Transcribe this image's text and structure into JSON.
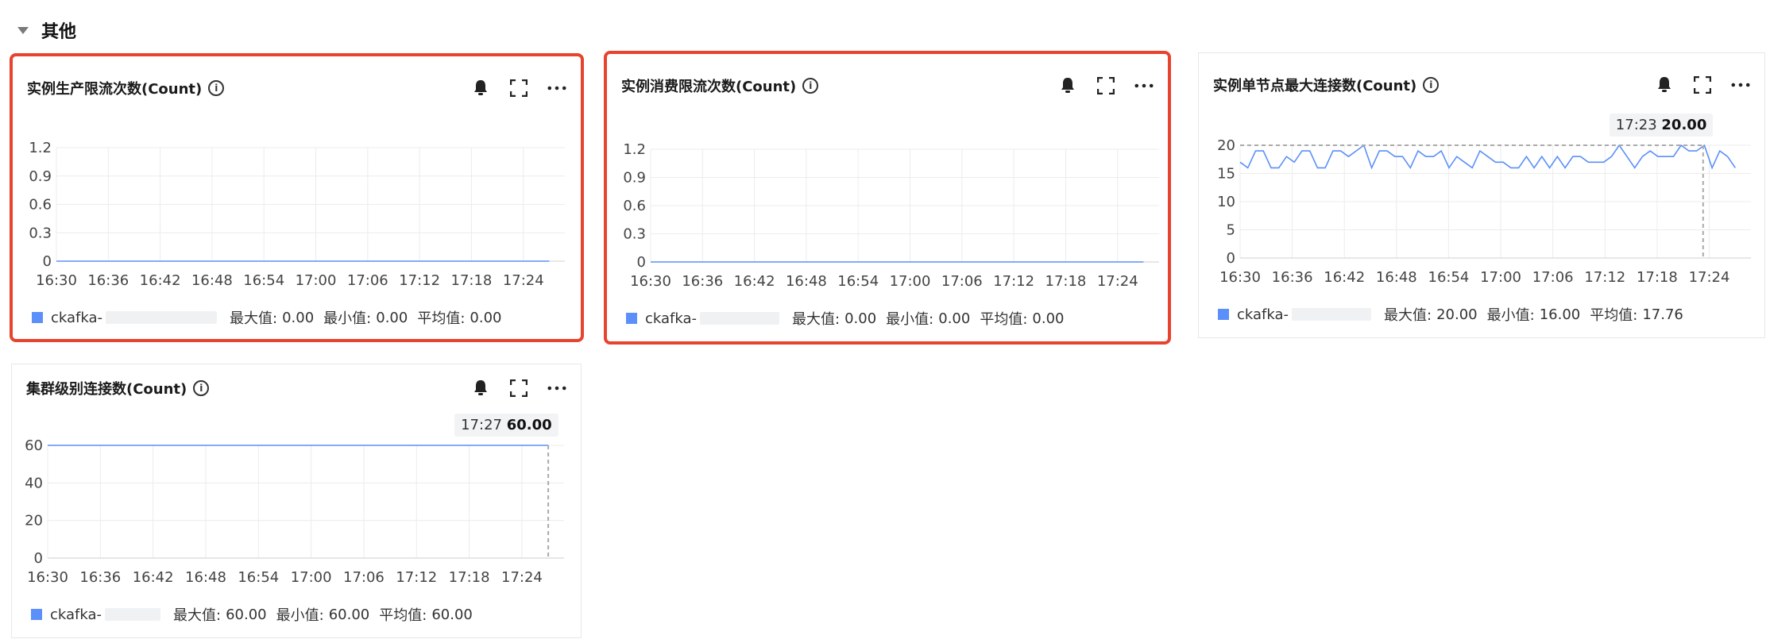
{
  "section": {
    "title": "其他"
  },
  "legend_labels": {
    "max": "最大值:",
    "min": "最小值:",
    "avg": "平均值:"
  },
  "colors": {
    "series": "#5b8ff9",
    "highlight": "#e8432e"
  },
  "cards": [
    {
      "title": "实例生产限流次数(Count)",
      "legend_name": "ckafka-",
      "stats": {
        "max": "0.00",
        "min": "0.00",
        "avg": "0.00"
      },
      "chart_data": {
        "type": "line",
        "x": [
          "16:30",
          "16:36",
          "16:42",
          "16:48",
          "16:54",
          "17:00",
          "17:06",
          "17:12",
          "17:18",
          "17:24"
        ],
        "yticks": [
          "1.2",
          "0.9",
          "0.6",
          "0.3",
          "0"
        ],
        "ylim": [
          0,
          1.2
        ],
        "series": [
          {
            "name": "ckafka-",
            "values": [
              0,
              0,
              0,
              0,
              0,
              0,
              0,
              0,
              0,
              0,
              0
            ]
          }
        ]
      }
    },
    {
      "title": "实例消费限流次数(Count)",
      "legend_name": "ckafka-",
      "stats": {
        "max": "0.00",
        "min": "0.00",
        "avg": "0.00"
      },
      "chart_data": {
        "type": "line",
        "x": [
          "16:30",
          "16:36",
          "16:42",
          "16:48",
          "16:54",
          "17:00",
          "17:06",
          "17:12",
          "17:18",
          "17:24"
        ],
        "yticks": [
          "1.2",
          "0.9",
          "0.6",
          "0.3",
          "0"
        ],
        "ylim": [
          0,
          1.2
        ],
        "series": [
          {
            "name": "ckafka-",
            "values": [
              0,
              0,
              0,
              0,
              0,
              0,
              0,
              0,
              0,
              0,
              0
            ]
          }
        ]
      }
    },
    {
      "title": "实例单节点最大连接数(Count)",
      "legend_name": "ckafka-",
      "stats": {
        "max": "20.00",
        "min": "16.00",
        "avg": "17.76"
      },
      "tooltip": {
        "time": "17:23",
        "value": "20.00"
      },
      "chart_data": {
        "type": "line",
        "x": [
          "16:30",
          "16:36",
          "16:42",
          "16:48",
          "16:54",
          "17:00",
          "17:06",
          "17:12",
          "17:18",
          "17:24"
        ],
        "yticks": [
          "20",
          "15",
          "10",
          "5",
          "0"
        ],
        "ylim": [
          0,
          20
        ],
        "series": [
          {
            "name": "ckafka-",
            "values": [
              17,
              16,
              19,
              19,
              16,
              16,
              18,
              17,
              19,
              19,
              16,
              16,
              19,
              19,
              18,
              19,
              20,
              16,
              19,
              19,
              18,
              18,
              16,
              19,
              18,
              18,
              19,
              16,
              18,
              17,
              16,
              19,
              18,
              17,
              17,
              16,
              16,
              18,
              16,
              18,
              16,
              18,
              16,
              18,
              18,
              17,
              17,
              17,
              18,
              20,
              18,
              16,
              18,
              19,
              18,
              18,
              18,
              20,
              19,
              19,
              20,
              16,
              19,
              18,
              16
            ]
          }
        ]
      }
    },
    {
      "title": "集群级别连接数(Count)",
      "legend_name": "ckafka-",
      "stats": {
        "max": "60.00",
        "min": "60.00",
        "avg": "60.00"
      },
      "tooltip": {
        "time": "17:27",
        "value": "60.00"
      },
      "chart_data": {
        "type": "line",
        "x": [
          "16:30",
          "16:36",
          "16:42",
          "16:48",
          "16:54",
          "17:00",
          "17:06",
          "17:12",
          "17:18",
          "17:24"
        ],
        "yticks": [
          "60",
          "40",
          "20",
          "0"
        ],
        "ylim": [
          0,
          60
        ],
        "series": [
          {
            "name": "ckafka-",
            "values": [
              60,
              60,
              60,
              60,
              60,
              60,
              60,
              60,
              60,
              60,
              60
            ]
          }
        ]
      }
    }
  ]
}
